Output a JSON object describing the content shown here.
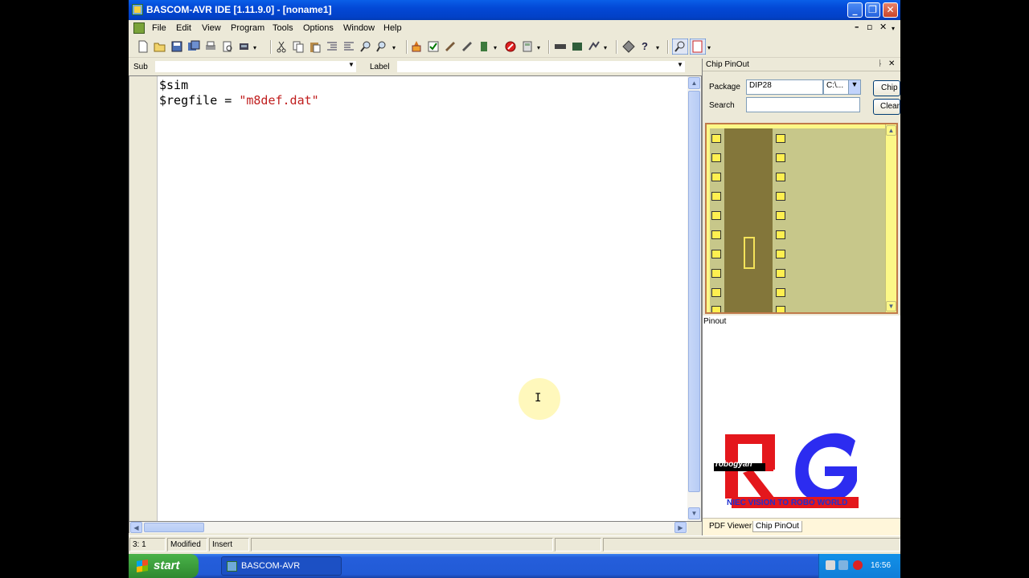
{
  "window": {
    "title": "BASCOM-AVR IDE [1.11.9.0] - [noname1]"
  },
  "menu": [
    "File",
    "Edit",
    "View",
    "Program",
    "Tools",
    "Options",
    "Window",
    "Help"
  ],
  "subbar": {
    "sub_label": "Sub",
    "label_label": "Label"
  },
  "editor": {
    "line1": "$sim",
    "line2_key": "$regfile",
    "line2_eq": " = ",
    "line2_str": "\"m8def.dat\""
  },
  "panel": {
    "title": "Chip PinOut",
    "package_label": "Package",
    "package_value": "DIP28",
    "path_value": "C:\\...",
    "search_label": "Search",
    "chip_button": "Chip",
    "clear_button": "Clear",
    "pinout_label": "Pinout",
    "tabs": [
      "PDF Viewer",
      "Chip PinOut"
    ]
  },
  "logo": {
    "brand": "robogyan",
    "tagline": "NIEC VISION TO ROBO WORLD"
  },
  "status": {
    "position": "3: 1",
    "modified": "Modified",
    "mode": "Insert"
  },
  "taskbar": {
    "start": "start",
    "task": "BASCOM-AVR",
    "clock": "16:56"
  },
  "colors": {
    "title_blue": "#0348d6",
    "string_red": "#c01e1e",
    "chip_yellow": "#fcf887"
  }
}
